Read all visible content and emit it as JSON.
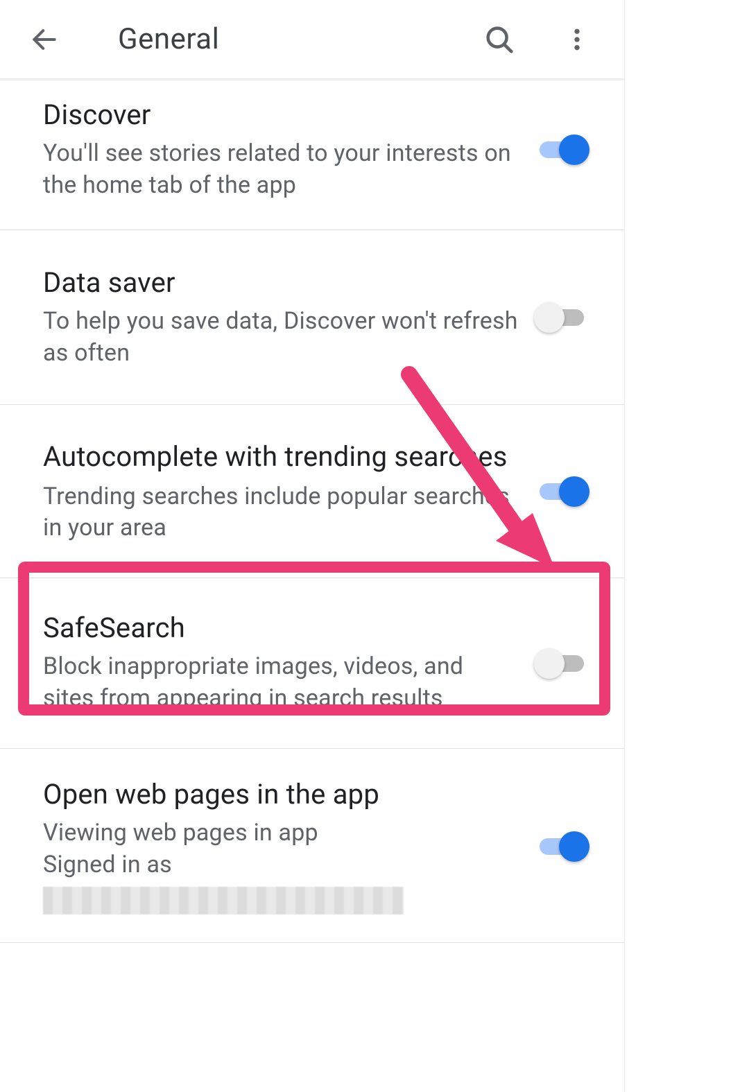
{
  "header": {
    "title": "General"
  },
  "settings": [
    {
      "key": "discover",
      "title": "Discover",
      "subtitle": "You'll see stories related to your interests on the home tab of the app",
      "enabled": true
    },
    {
      "key": "data_saver",
      "title": "Data saver",
      "subtitle": "To help you save data, Discover won't refresh as often",
      "enabled": false
    },
    {
      "key": "autocomplete_trending",
      "title": "Autocomplete with trending searches",
      "subtitle": "Trending searches include popular searches in your area",
      "enabled": true
    },
    {
      "key": "safesearch",
      "title": "SafeSearch",
      "subtitle": "Block inappropriate images, videos, and sites from appearing in search results",
      "enabled": false,
      "highlighted": true
    },
    {
      "key": "open_in_app",
      "title": "Open web pages in the app",
      "subtitle_line1": "Viewing web pages in app",
      "subtitle_line2": "Signed in as",
      "enabled": true
    }
  ],
  "annotation": {
    "arrow_color": "#ec3b72",
    "highlight_color": "#ec3b72"
  }
}
